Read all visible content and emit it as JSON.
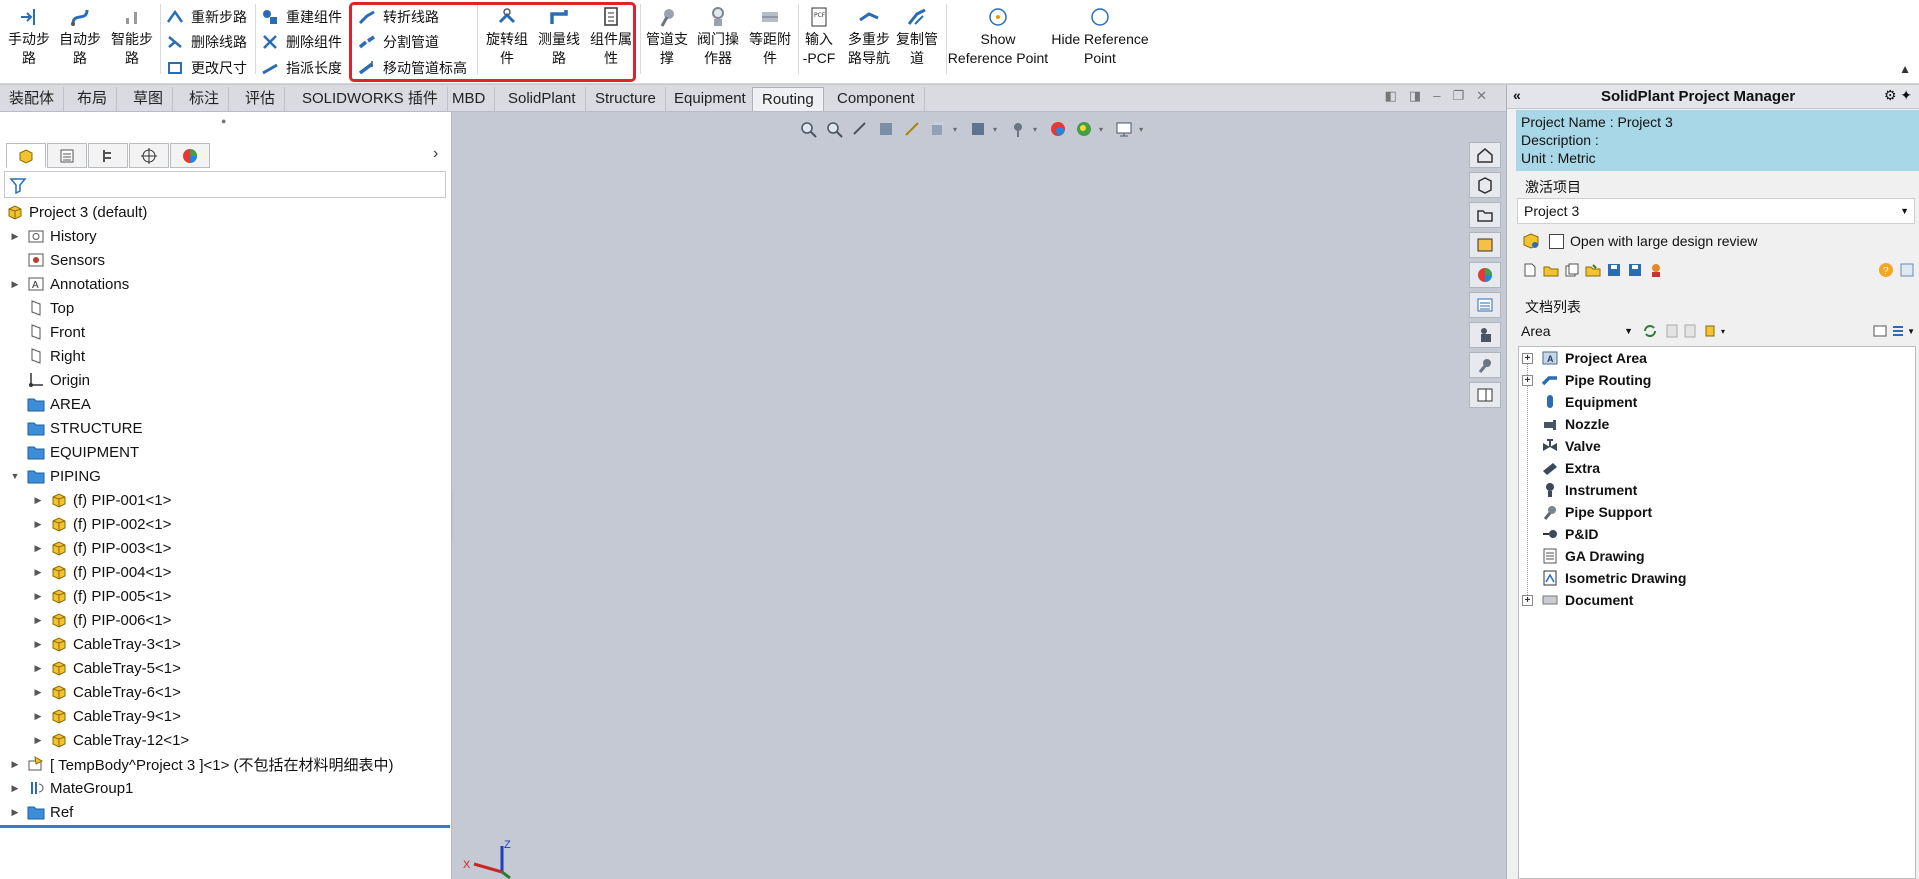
{
  "ribbon": {
    "left_buttons": [
      {
        "label": "手动步\n路",
        "icon": "manual-route-icon"
      },
      {
        "label": "自动步\n路",
        "icon": "auto-route-icon"
      },
      {
        "label": "智能步\n路",
        "icon": "smart-route-icon"
      }
    ],
    "col1": [
      {
        "label": "重新步路",
        "icon": "reroute-icon"
      },
      {
        "label": "删除线路",
        "icon": "delete-route-icon"
      },
      {
        "label": "更改尺寸",
        "icon": "change-size-icon"
      }
    ],
    "col2": [
      {
        "label": "重建组件",
        "icon": "rebuild-component-icon"
      },
      {
        "label": "删除组件",
        "icon": "delete-component-icon"
      },
      {
        "label": "指派长度",
        "icon": "assign-length-icon"
      }
    ],
    "col3": [
      {
        "label": "转折线路",
        "icon": "bend-route-icon"
      },
      {
        "label": "分割管道",
        "icon": "split-pipe-icon"
      },
      {
        "label": "移动管道标高",
        "icon": "move-elevation-icon"
      }
    ],
    "mid_buttons": [
      {
        "label": "旋转组\n件",
        "icon": "rotate-component-icon"
      },
      {
        "label": "测量线\n路",
        "icon": "measure-route-icon"
      },
      {
        "label": "组件属\n性",
        "icon": "component-properties-icon"
      }
    ],
    "right_buttons": [
      {
        "label": "管道支\n撑",
        "icon": "pipe-support-icon"
      },
      {
        "label": "阀门操\n作器",
        "icon": "valve-operator-icon"
      },
      {
        "label": "等距附\n件",
        "icon": "equidistant-attach-icon"
      },
      {
        "label": "输入\n-PCF",
        "icon": "import-pcf-icon"
      },
      {
        "label": "多重步\n路导航",
        "icon": "multi-route-nav-icon"
      },
      {
        "label": "复制管\n道",
        "icon": "copy-pipe-icon"
      }
    ],
    "ref_buttons": [
      {
        "label": "Show\nReference Point",
        "icon": "show-ref-point-icon"
      },
      {
        "label": "Hide Reference\nPoint",
        "icon": "hide-ref-point-icon"
      }
    ]
  },
  "tabs": [
    "装配体",
    "布局",
    "草图",
    "标注",
    "评估",
    "SOLIDWORKS 插件",
    "MBD",
    "SolidPlant",
    "Structure",
    "Equipment",
    "Routing",
    "Component"
  ],
  "active_tab": "Routing",
  "feature_tree": [
    {
      "label": "Project 3  (default)",
      "icon": "assembly-icon",
      "level": 0,
      "toggle": ""
    },
    {
      "label": "History",
      "icon": "history-icon",
      "level": 1,
      "toggle": "▶"
    },
    {
      "label": "Sensors",
      "icon": "sensor-icon",
      "level": 1,
      "toggle": ""
    },
    {
      "label": "Annotations",
      "icon": "annotation-icon",
      "level": 1,
      "toggle": "▶"
    },
    {
      "label": "Top",
      "icon": "plane-icon",
      "level": 1,
      "toggle": ""
    },
    {
      "label": "Front",
      "icon": "plane-icon",
      "level": 1,
      "toggle": ""
    },
    {
      "label": "Right",
      "icon": "plane-icon",
      "level": 1,
      "toggle": ""
    },
    {
      "label": "Origin",
      "icon": "origin-icon",
      "level": 1,
      "toggle": ""
    },
    {
      "label": "AREA",
      "icon": "folder-icon",
      "level": 1,
      "toggle": ""
    },
    {
      "label": "STRUCTURE",
      "icon": "folder-icon",
      "level": 1,
      "toggle": ""
    },
    {
      "label": "EQUIPMENT",
      "icon": "folder-icon",
      "level": 1,
      "toggle": ""
    },
    {
      "label": "PIPING",
      "icon": "folder-icon",
      "level": 1,
      "toggle": "▼"
    },
    {
      "label": "(f) PIP-001<1>",
      "icon": "subassembly-icon",
      "level": 2,
      "toggle": "▶"
    },
    {
      "label": "(f) PIP-002<1>",
      "icon": "subassembly-icon",
      "level": 2,
      "toggle": "▶"
    },
    {
      "label": "(f) PIP-003<1>",
      "icon": "subassembly-icon",
      "level": 2,
      "toggle": "▶"
    },
    {
      "label": "(f) PIP-004<1>",
      "icon": "subassembly-icon",
      "level": 2,
      "toggle": "▶"
    },
    {
      "label": "(f) PIP-005<1>",
      "icon": "subassembly-icon",
      "level": 2,
      "toggle": "▶"
    },
    {
      "label": "(f) PIP-006<1>",
      "icon": "subassembly-icon",
      "level": 2,
      "toggle": "▶"
    },
    {
      "label": "CableTray-3<1>",
      "icon": "subassembly-icon",
      "level": 2,
      "toggle": "▶"
    },
    {
      "label": "CableTray-5<1>",
      "icon": "subassembly-icon",
      "level": 2,
      "toggle": "▶"
    },
    {
      "label": "CableTray-6<1>",
      "icon": "subassembly-icon",
      "level": 2,
      "toggle": "▶"
    },
    {
      "label": "CableTray-9<1>",
      "icon": "subassembly-icon",
      "level": 2,
      "toggle": "▶"
    },
    {
      "label": "CableTray-12<1>",
      "icon": "subassembly-icon",
      "level": 2,
      "toggle": "▶"
    },
    {
      "label": "[ TempBody^Project 3 ]<1> (不包括在材料明细表中)",
      "icon": "part-envelope-icon",
      "level": 1,
      "toggle": "▶"
    },
    {
      "label": "MateGroup1",
      "icon": "mates-icon",
      "level": 1,
      "toggle": "▶"
    },
    {
      "label": "Ref",
      "icon": "folder-icon",
      "level": 1,
      "toggle": "▶"
    }
  ],
  "right_panel": {
    "title": "SolidPlant Project Manager",
    "project_name": "Project Name : Project 3",
    "description": "Description :",
    "unit": "Unit : Metric",
    "active_project_label": "激活项目",
    "active_project_value": "Project 3",
    "open_large_label": "Open with large design review",
    "doc_list_label": "文档列表",
    "area_select": "Area",
    "doc_tree": [
      {
        "label": "Project Area",
        "icon": "project-area-icon",
        "expander": "+"
      },
      {
        "label": "Pipe Routing",
        "icon": "pipe-routing-icon",
        "expander": "+"
      },
      {
        "label": "Equipment",
        "icon": "equipment-icon",
        "expander": ""
      },
      {
        "label": "Nozzle",
        "icon": "nozzle-icon",
        "expander": ""
      },
      {
        "label": "Valve",
        "icon": "valve-icon",
        "expander": ""
      },
      {
        "label": "Extra",
        "icon": "extra-icon",
        "expander": ""
      },
      {
        "label": "Instrument",
        "icon": "instrument-icon",
        "expander": ""
      },
      {
        "label": "Pipe Support",
        "icon": "pipe-support-icon",
        "expander": ""
      },
      {
        "label": "P&ID",
        "icon": "pid-icon",
        "expander": ""
      },
      {
        "label": "GA Drawing",
        "icon": "ga-drawing-icon",
        "expander": ""
      },
      {
        "label": "Isometric Drawing",
        "icon": "isometric-drawing-icon",
        "expander": ""
      },
      {
        "label": "Document",
        "icon": "document-icon",
        "expander": "+"
      }
    ]
  },
  "colors": {
    "highlight": "#e2222a",
    "info_bg": "#a8d8e8",
    "viewport_bg": "#c5c9d3",
    "selection_bar": "#2f7fd1"
  }
}
